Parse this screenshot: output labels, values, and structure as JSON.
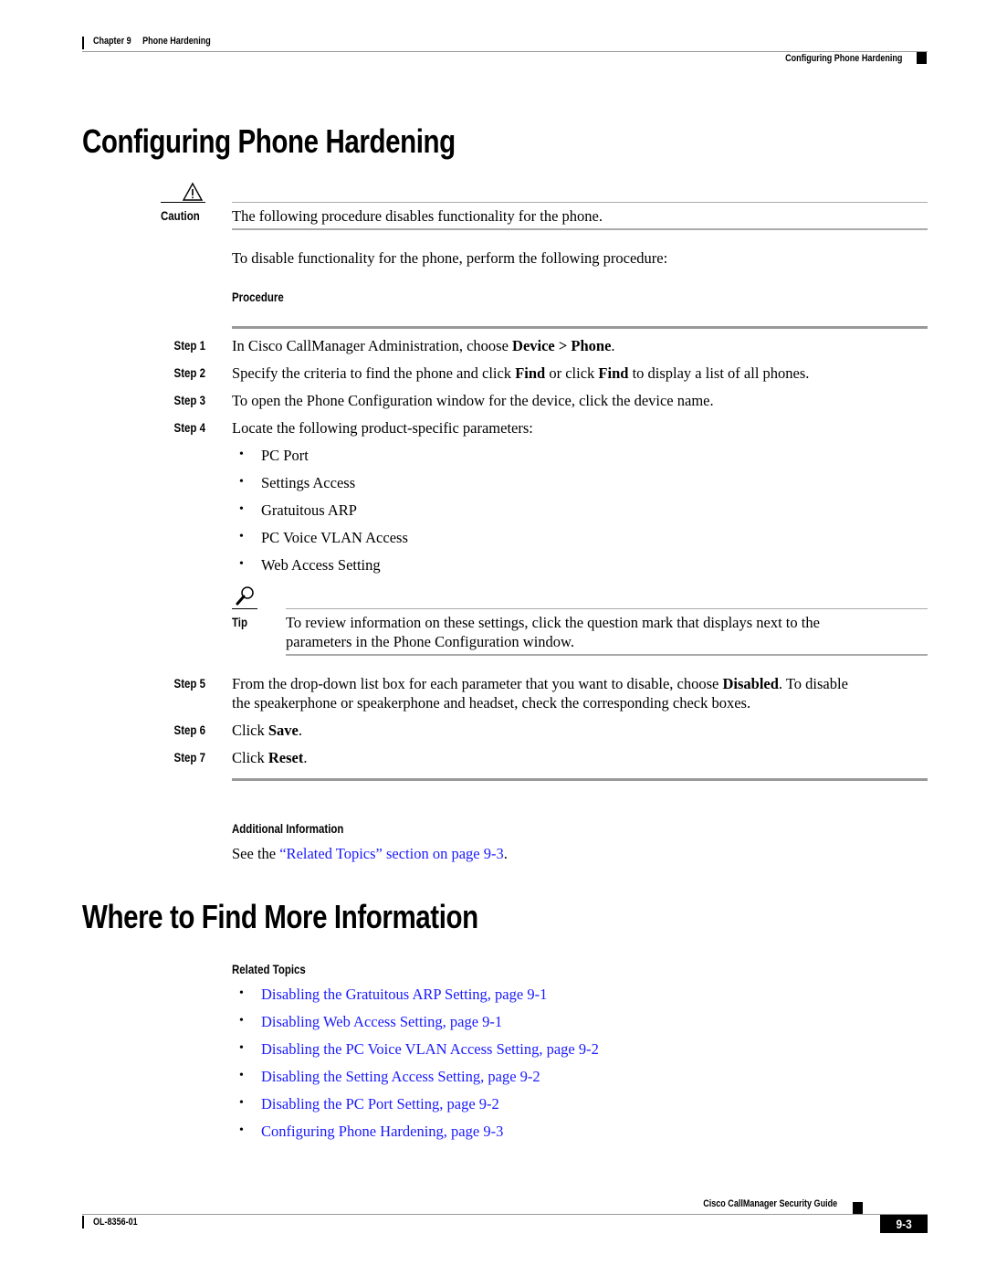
{
  "header": {
    "chapter": "Chapter 9",
    "chapter_title": "Phone Hardening",
    "section": "Configuring Phone Hardening"
  },
  "section1": {
    "title": "Configuring Phone Hardening",
    "caution_label": "Caution",
    "caution_icon": "warning-triangle-icon",
    "caution_text": "The following procedure disables functionality for the phone.",
    "intro": "To disable functionality for the phone, perform the following procedure:",
    "procedure_label": "Procedure",
    "steps": [
      {
        "label": "Step 1",
        "parts": [
          "In Cisco CallManager Administration, choose ",
          "Device > Phone",
          "."
        ]
      },
      {
        "label": "Step 2",
        "parts": [
          "Specify the criteria to find the phone and click ",
          "Find",
          " or click ",
          "Find",
          " to display a list of all phones."
        ]
      },
      {
        "label": "Step 3",
        "text": "To open the Phone Configuration window for the device, click the device name."
      },
      {
        "label": "Step 4",
        "text": "Locate the following product-specific parameters:"
      },
      {
        "label": "Step 5",
        "parts": [
          "From the drop-down list box for each parameter that you want to disable, choose ",
          "Disabled",
          ". To disable",
          "the speakerphone or speakerphone and headset, check the corresponding check boxes."
        ]
      },
      {
        "label": "Step 6",
        "parts": [
          "Click ",
          "Save",
          "."
        ]
      },
      {
        "label": "Step 7",
        "parts": [
          "Click ",
          "Reset",
          "."
        ]
      }
    ],
    "parameters": [
      "PC Port",
      "Settings Access",
      "Gratuitous ARP",
      "PC Voice VLAN Access",
      "Web Access Setting"
    ],
    "tip_label": "Tip",
    "tip_icon": "magnifier-icon",
    "tip_text_1": "To review information on these settings, click the question mark that displays next to the",
    "tip_text_2": "parameters in the Phone Configuration window.",
    "additional_label": "Additional Information",
    "additional_prefix": "See the ",
    "additional_link": "“Related Topics” section on page 9-3",
    "additional_suffix": "."
  },
  "section2": {
    "title": "Where to Find More Information",
    "related_label": "Related Topics",
    "links": [
      "Disabling the Gratuitous ARP Setting, page 9-1",
      "Disabling Web Access Setting, page 9-1",
      "Disabling the PC Voice VLAN Access Setting, page 9-2",
      "Disabling the Setting Access Setting, page 9-2",
      "Disabling the PC Port Setting, page 9-2",
      "Configuring Phone Hardening, page 9-3"
    ]
  },
  "footer": {
    "guide_title": "Cisco CallManager Security Guide",
    "doc_number": "OL-8356-01",
    "page_number": "9-3"
  },
  "colors": {
    "link": "#1a1aff",
    "rule": "#999999"
  }
}
